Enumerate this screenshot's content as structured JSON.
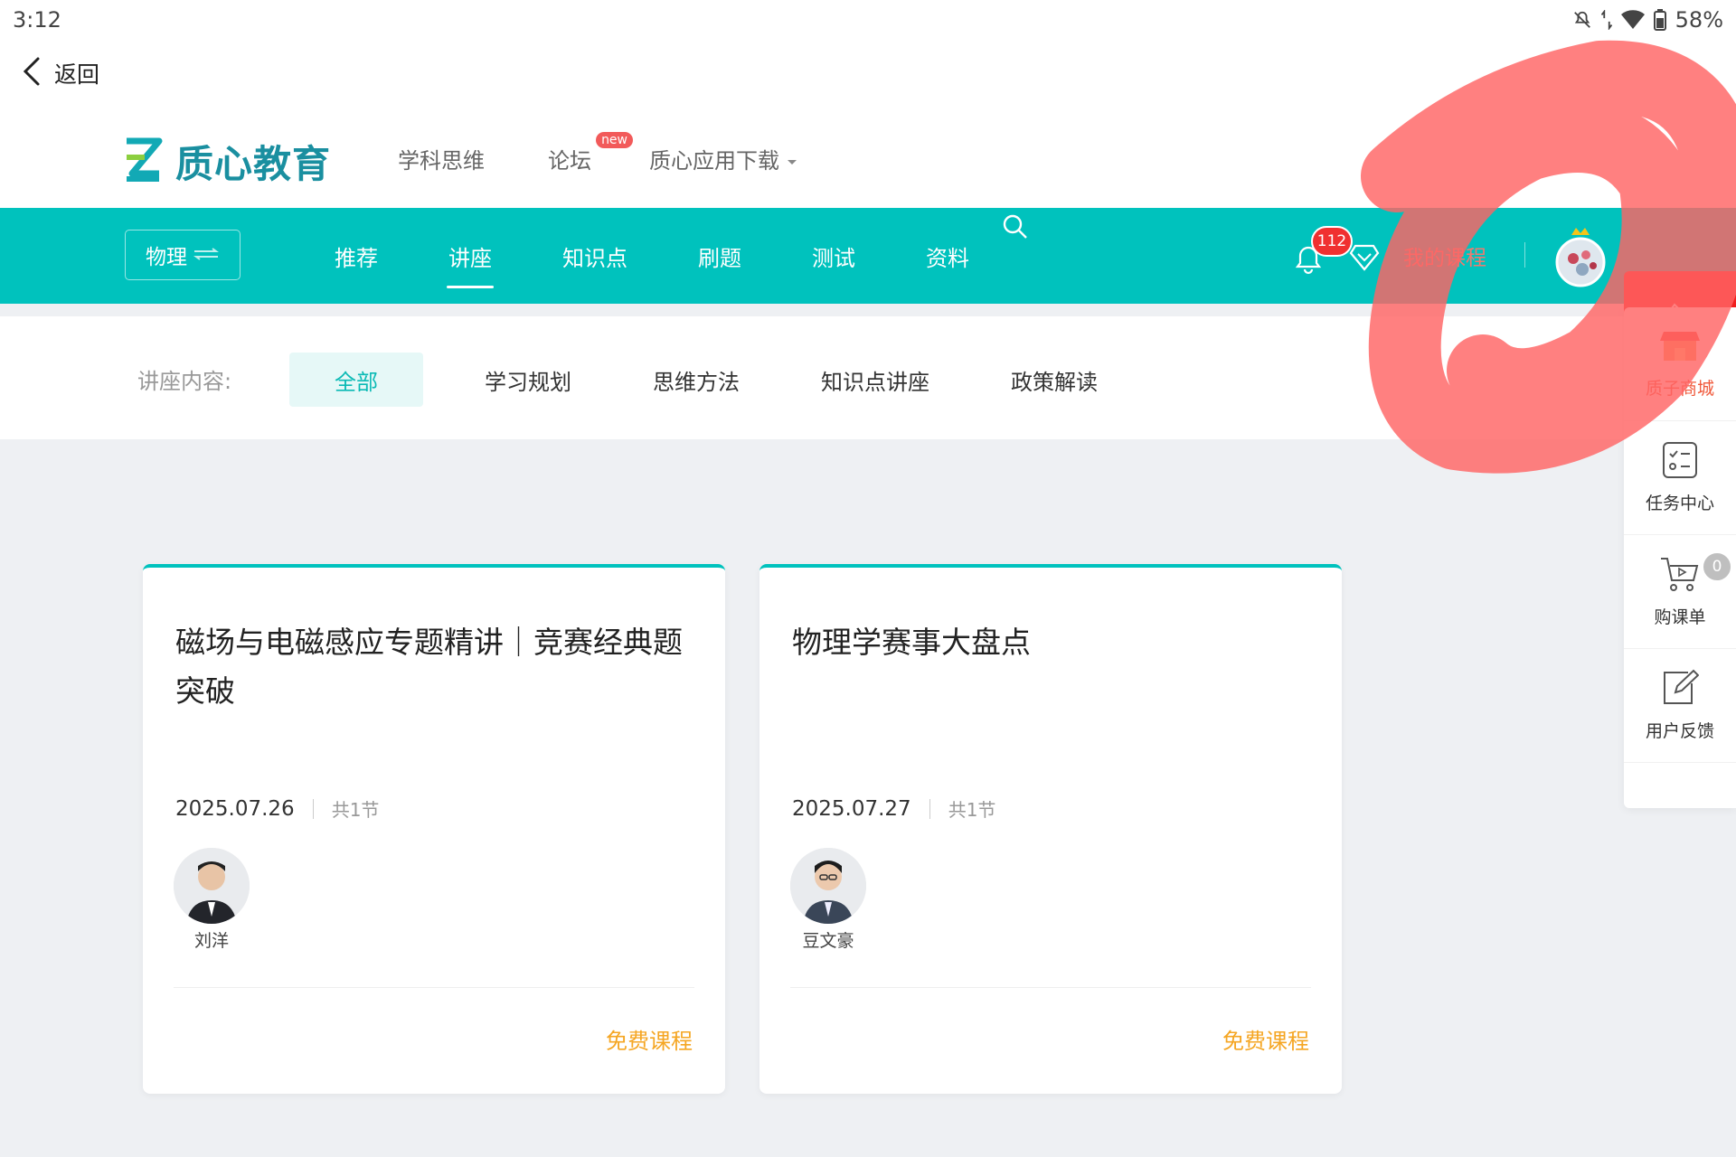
{
  "status_bar": {
    "time": "3:12",
    "battery": "58%"
  },
  "back": {
    "label": "返回"
  },
  "header": {
    "logo_text": "质心教育",
    "top_nav": [
      {
        "label": "学科思维"
      },
      {
        "label": "论坛",
        "badge": "new"
      },
      {
        "label": "质心应用下载"
      }
    ]
  },
  "main_nav": {
    "subject": "物理",
    "tabs": [
      {
        "label": "推荐"
      },
      {
        "label": "讲座",
        "active": true
      },
      {
        "label": "知识点"
      },
      {
        "label": "刷题"
      },
      {
        "label": "测试"
      },
      {
        "label": "资料"
      }
    ],
    "notification_count": "112",
    "my_course": "我的课程"
  },
  "filter": {
    "label": "讲座内容:",
    "options": [
      {
        "label": "全部",
        "active": true
      },
      {
        "label": "学习规划"
      },
      {
        "label": "思维方法"
      },
      {
        "label": "知识点讲座"
      },
      {
        "label": "政策解读"
      }
    ]
  },
  "cards": [
    {
      "title": "磁场与电磁感应专题精讲｜竞赛经典题突破",
      "date": "2025.07.26",
      "lessons": "共1节",
      "teacher": "刘洋",
      "tag": "免费课程"
    },
    {
      "title": "物理学赛事大盘点",
      "date": "2025.07.27",
      "lessons": "共1节",
      "teacher": "豆文豪",
      "tag": "免费课程"
    }
  ],
  "float_panel": {
    "items": [
      {
        "label": "质子商城",
        "icon": "shop-icon"
      },
      {
        "label": "任务中心",
        "icon": "task-icon"
      },
      {
        "label": "购课单",
        "icon": "cart-icon",
        "badge": "0"
      },
      {
        "label": "用户反馈",
        "icon": "feedback-icon"
      }
    ]
  },
  "colors": {
    "brand_teal": "#00c2bd",
    "accent_orange": "#f5a623",
    "annotation_red": "#ff6464"
  }
}
